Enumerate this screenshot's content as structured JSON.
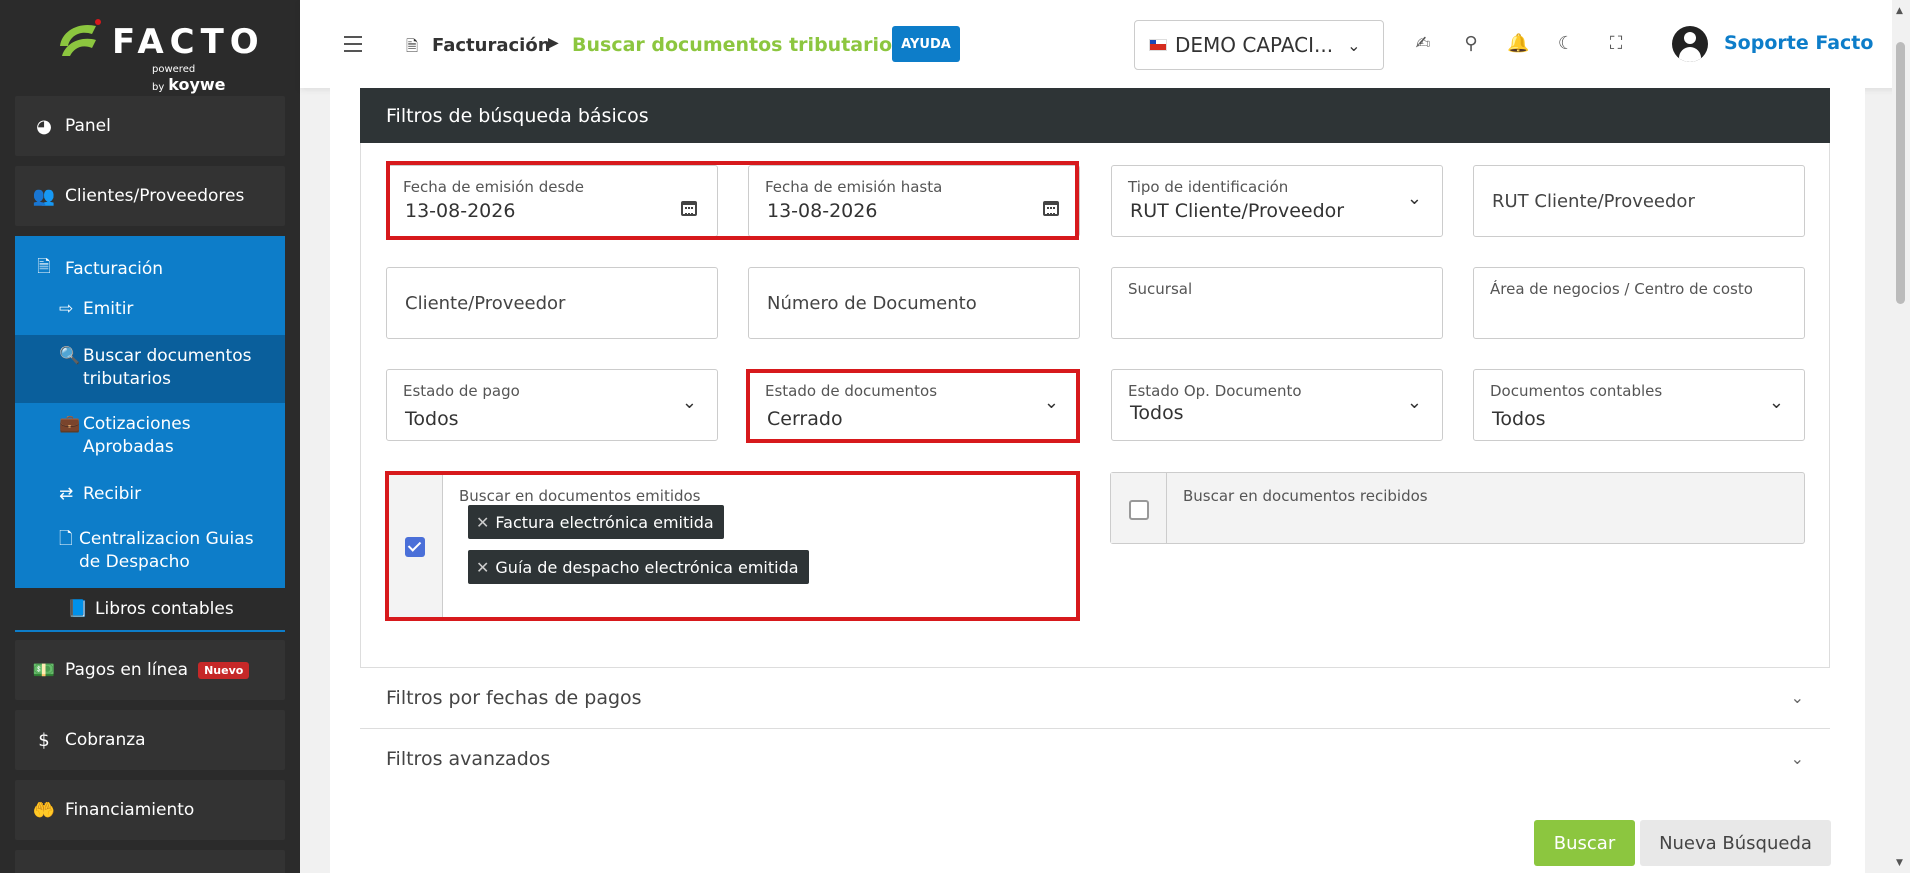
{
  "brand": {
    "name": "FACTO",
    "powered_by": "powered by",
    "partner": "koywe"
  },
  "sidebar": {
    "items": [
      {
        "label": "Panel",
        "icon": "pie-chart-icon"
      },
      {
        "label": "Clientes/Proveedores",
        "icon": "users-icon"
      },
      {
        "label": "Facturación",
        "icon": "document-icon"
      },
      {
        "label": "Pagos en línea",
        "icon": "money-icon",
        "badge": "Nuevo"
      },
      {
        "label": "Cobranza",
        "icon": "dollar-icon"
      },
      {
        "label": "Financiamiento",
        "icon": "hand-money-icon"
      }
    ],
    "facturacion_sub": [
      {
        "label": "Emitir",
        "icon": "sign-out-icon"
      },
      {
        "label": "Buscar documentos tributarios",
        "icon": "search-icon"
      },
      {
        "label": "Cotizaciones Aprobadas",
        "icon": "briefcase-icon"
      },
      {
        "label": "Recibir",
        "icon": "shuffle-icon"
      },
      {
        "label": "Centralizacion Guias de Despacho",
        "icon": "file-icon"
      }
    ],
    "libros": "Libros contables"
  },
  "header": {
    "crumb1": "Facturación",
    "crumb2": "Buscar documentos tributarios",
    "help": "AYUDA",
    "company": "DEMO CAPACI...",
    "user": "Soporte Facto"
  },
  "filters": {
    "title": "Filtros de búsqueda básicos",
    "fecha_desde": {
      "label": "Fecha de emisión desde",
      "value": "13-08-2026"
    },
    "fecha_hasta": {
      "label": "Fecha de emisión hasta",
      "value": "13-08-2026"
    },
    "tipo_id": {
      "label": "Tipo de identificación",
      "value": "RUT Cliente/Proveedor"
    },
    "rut": {
      "placeholder": "RUT Cliente/Proveedor"
    },
    "cliente": {
      "placeholder": "Cliente/Proveedor"
    },
    "numero": {
      "placeholder": "Número de Documento"
    },
    "sucursal": {
      "label": "Sucursal"
    },
    "area": {
      "label": "Área de negocios / Centro de costo"
    },
    "estado_pago": {
      "label": "Estado de pago",
      "value": "Todos"
    },
    "estado_docs": {
      "label": "Estado de documentos",
      "value": "Cerrado"
    },
    "estado_op": {
      "label": "Estado Op. Documento",
      "value": "Todos"
    },
    "docs_contables": {
      "label": "Documentos contables",
      "value": "Todos"
    },
    "emitidos": {
      "label": "Buscar en documentos emitidos",
      "checked": true,
      "tags": [
        "Factura electrónica emitida",
        "Guía de despacho electrónica emitida"
      ]
    },
    "recibidos": {
      "label": "Buscar en documentos recibidos",
      "checked": false
    }
  },
  "accordions": [
    "Filtros por fechas de pagos",
    "Filtros avanzados"
  ],
  "actions": {
    "search": "Buscar",
    "new_search": "Nueva Búsqueda"
  },
  "colors": {
    "accent_blue": "#0d7dc9",
    "accent_green": "#8cc63f",
    "highlight_red": "#d7191c",
    "sidebar_bg": "#2b2b2b"
  }
}
